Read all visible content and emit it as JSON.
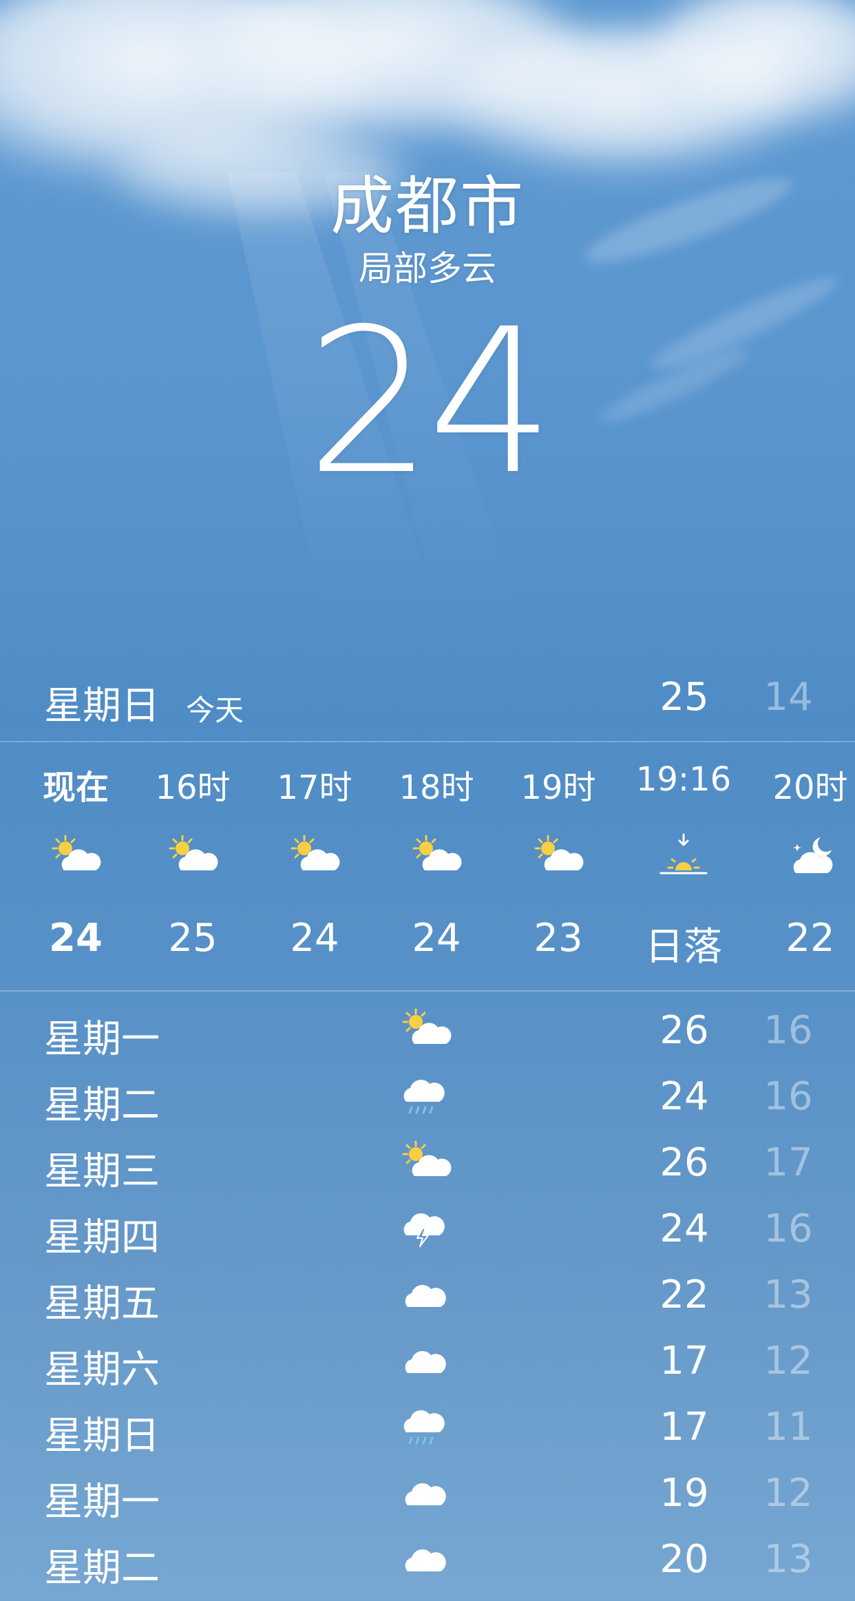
{
  "location": {
    "city": "成都市",
    "condition": "局部多云",
    "temperature": "24"
  },
  "today": {
    "day": "星期日",
    "label": "今天",
    "high": "25",
    "low": "14"
  },
  "hourly": [
    {
      "time": "现在",
      "icon": "partly-cloudy-day-icon",
      "temp": "24"
    },
    {
      "time": "16时",
      "icon": "partly-cloudy-day-icon",
      "temp": "25"
    },
    {
      "time": "17时",
      "icon": "partly-cloudy-day-icon",
      "temp": "24"
    },
    {
      "time": "18时",
      "icon": "partly-cloudy-day-icon",
      "temp": "24"
    },
    {
      "time": "19时",
      "icon": "partly-cloudy-day-icon",
      "temp": "23"
    },
    {
      "time": "19:16",
      "icon": "sunset-icon",
      "temp": "日落"
    },
    {
      "time": "20时",
      "icon": "partly-cloudy-night-icon",
      "temp": "22"
    }
  ],
  "daily": [
    {
      "day": "星期一",
      "icon": "partly-cloudy-day-icon",
      "high": "26",
      "low": "16"
    },
    {
      "day": "星期二",
      "icon": "rain-icon",
      "high": "24",
      "low": "16"
    },
    {
      "day": "星期三",
      "icon": "partly-cloudy-day-icon",
      "high": "26",
      "low": "17"
    },
    {
      "day": "星期四",
      "icon": "thunderstorm-icon",
      "high": "24",
      "low": "16"
    },
    {
      "day": "星期五",
      "icon": "cloud-icon",
      "high": "22",
      "low": "13"
    },
    {
      "day": "星期六",
      "icon": "cloud-icon",
      "high": "17",
      "low": "12"
    },
    {
      "day": "星期日",
      "icon": "rain-icon",
      "high": "17",
      "low": "11"
    },
    {
      "day": "星期一",
      "icon": "cloud-icon",
      "high": "19",
      "low": "12"
    },
    {
      "day": "星期二",
      "icon": "cloud-icon",
      "high": "20",
      "low": "13"
    }
  ],
  "colors": {
    "sky": "#5a95cf",
    "sun": "#f7cf45",
    "rain": "#7cc4f2",
    "low_temp": "rgba(255,255,255,0.42)"
  }
}
